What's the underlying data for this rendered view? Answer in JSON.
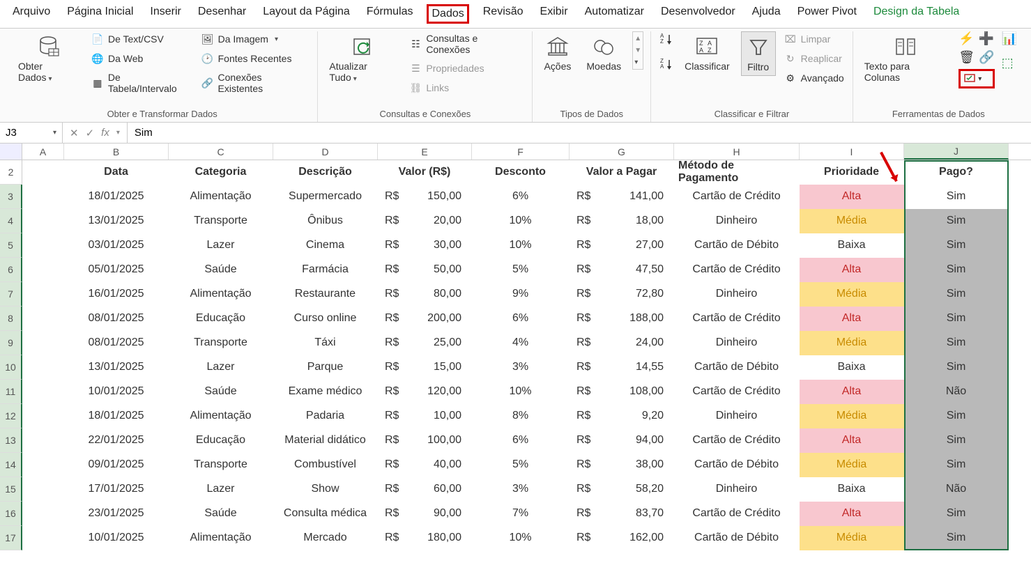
{
  "menu": {
    "items": [
      "Arquivo",
      "Página Inicial",
      "Inserir",
      "Desenhar",
      "Layout da Página",
      "Fórmulas",
      "Dados",
      "Revisão",
      "Exibir",
      "Automatizar",
      "Desenvolvedor",
      "Ajuda",
      "Power Pivot",
      "Design da Tabela"
    ],
    "active_index": 6,
    "design_index": 13
  },
  "ribbon": {
    "group1": {
      "label": "Obter e Transformar Dados",
      "get_data": "Obter Dados",
      "text_csv": "De Text/CSV",
      "da_web": "Da Web",
      "tabela_intervalo": "De Tabela/Intervalo",
      "da_imagem": "Da Imagem",
      "fontes_recentes": "Fontes Recentes",
      "conexoes": "Conexões Existentes"
    },
    "group2": {
      "label": "Consultas e Conexões",
      "atualizar": "Atualizar Tudo",
      "consultas": "Consultas e Conexões",
      "propriedades": "Propriedades",
      "links": "Links"
    },
    "group3": {
      "label": "Tipos de Dados",
      "acoes": "Ações",
      "moedas": "Moedas"
    },
    "group4": {
      "label": "Classificar e Filtrar",
      "classificar": "Classificar",
      "filtro": "Filtro",
      "limpar": "Limpar",
      "reaplicar": "Reaplicar",
      "avancado": "Avançado"
    },
    "group5": {
      "label": "Ferramentas de Dados",
      "texto_colunas": "Texto para Colunas"
    }
  },
  "formula_bar": {
    "name_box": "J3",
    "formula": "Sim"
  },
  "columns": [
    "A",
    "B",
    "C",
    "D",
    "E",
    "F",
    "G",
    "H",
    "I",
    "J"
  ],
  "headers": {
    "B": "Data",
    "C": "Categoria",
    "D": "Descrição",
    "E": "Valor (R$)",
    "F": "Desconto",
    "G": "Valor a Pagar",
    "H": "Método de Pagamento",
    "I": "Prioridade",
    "J": "Pago?"
  },
  "rows": [
    {
      "n": 3,
      "B": "18/01/2025",
      "C": "Alimentação",
      "D": "Supermercado",
      "E_cur": "R$",
      "E": "150,00",
      "F": "6%",
      "G_cur": "R$",
      "G": "141,00",
      "H": "Cartão de Crédito",
      "I": "Alta",
      "J": "Sim"
    },
    {
      "n": 4,
      "B": "13/01/2025",
      "C": "Transporte",
      "D": "Ônibus",
      "E_cur": "R$",
      "E": "20,00",
      "F": "10%",
      "G_cur": "R$",
      "G": "18,00",
      "H": "Dinheiro",
      "I": "Média",
      "J": "Sim"
    },
    {
      "n": 5,
      "B": "03/01/2025",
      "C": "Lazer",
      "D": "Cinema",
      "E_cur": "R$",
      "E": "30,00",
      "F": "10%",
      "G_cur": "R$",
      "G": "27,00",
      "H": "Cartão de Débito",
      "I": "Baixa",
      "J": "Sim"
    },
    {
      "n": 6,
      "B": "05/01/2025",
      "C": "Saúde",
      "D": "Farmácia",
      "E_cur": "R$",
      "E": "50,00",
      "F": "5%",
      "G_cur": "R$",
      "G": "47,50",
      "H": "Cartão de Crédito",
      "I": "Alta",
      "J": "Sim"
    },
    {
      "n": 7,
      "B": "16/01/2025",
      "C": "Alimentação",
      "D": "Restaurante",
      "E_cur": "R$",
      "E": "80,00",
      "F": "9%",
      "G_cur": "R$",
      "G": "72,80",
      "H": "Dinheiro",
      "I": "Média",
      "J": "Sim"
    },
    {
      "n": 8,
      "B": "08/01/2025",
      "C": "Educação",
      "D": "Curso online",
      "E_cur": "R$",
      "E": "200,00",
      "F": "6%",
      "G_cur": "R$",
      "G": "188,00",
      "H": "Cartão de Crédito",
      "I": "Alta",
      "J": "Sim"
    },
    {
      "n": 9,
      "B": "08/01/2025",
      "C": "Transporte",
      "D": "Táxi",
      "E_cur": "R$",
      "E": "25,00",
      "F": "4%",
      "G_cur": "R$",
      "G": "24,00",
      "H": "Dinheiro",
      "I": "Média",
      "J": "Sim"
    },
    {
      "n": 10,
      "B": "13/01/2025",
      "C": "Lazer",
      "D": "Parque",
      "E_cur": "R$",
      "E": "15,00",
      "F": "3%",
      "G_cur": "R$",
      "G": "14,55",
      "H": "Cartão de Débito",
      "I": "Baixa",
      "J": "Sim"
    },
    {
      "n": 11,
      "B": "10/01/2025",
      "C": "Saúde",
      "D": "Exame médico",
      "E_cur": "R$",
      "E": "120,00",
      "F": "10%",
      "G_cur": "R$",
      "G": "108,00",
      "H": "Cartão de Crédito",
      "I": "Alta",
      "J": "Não"
    },
    {
      "n": 12,
      "B": "18/01/2025",
      "C": "Alimentação",
      "D": "Padaria",
      "E_cur": "R$",
      "E": "10,00",
      "F": "8%",
      "G_cur": "R$",
      "G": "9,20",
      "H": "Dinheiro",
      "I": "Média",
      "J": "Sim"
    },
    {
      "n": 13,
      "B": "22/01/2025",
      "C": "Educação",
      "D": "Material didático",
      "E_cur": "R$",
      "E": "100,00",
      "F": "6%",
      "G_cur": "R$",
      "G": "94,00",
      "H": "Cartão de Crédito",
      "I": "Alta",
      "J": "Sim"
    },
    {
      "n": 14,
      "B": "09/01/2025",
      "C": "Transporte",
      "D": "Combustível",
      "E_cur": "R$",
      "E": "40,00",
      "F": "5%",
      "G_cur": "R$",
      "G": "38,00",
      "H": "Cartão de Débito",
      "I": "Média",
      "J": "Sim"
    },
    {
      "n": 15,
      "B": "17/01/2025",
      "C": "Lazer",
      "D": "Show",
      "E_cur": "R$",
      "E": "60,00",
      "F": "3%",
      "G_cur": "R$",
      "G": "58,20",
      "H": "Dinheiro",
      "I": "Baixa",
      "J": "Não"
    },
    {
      "n": 16,
      "B": "23/01/2025",
      "C": "Saúde",
      "D": "Consulta médica",
      "E_cur": "R$",
      "E": "90,00",
      "F": "7%",
      "G_cur": "R$",
      "G": "83,70",
      "H": "Cartão de Crédito",
      "I": "Alta",
      "J": "Sim"
    },
    {
      "n": 17,
      "B": "10/01/2025",
      "C": "Alimentação",
      "D": "Mercado",
      "E_cur": "R$",
      "E": "180,00",
      "F": "10%",
      "G_cur": "R$",
      "G": "162,00",
      "H": "Cartão de Débito",
      "I": "Média",
      "J": "Sim"
    }
  ],
  "selected_column": "J",
  "active_cell_row": 3
}
